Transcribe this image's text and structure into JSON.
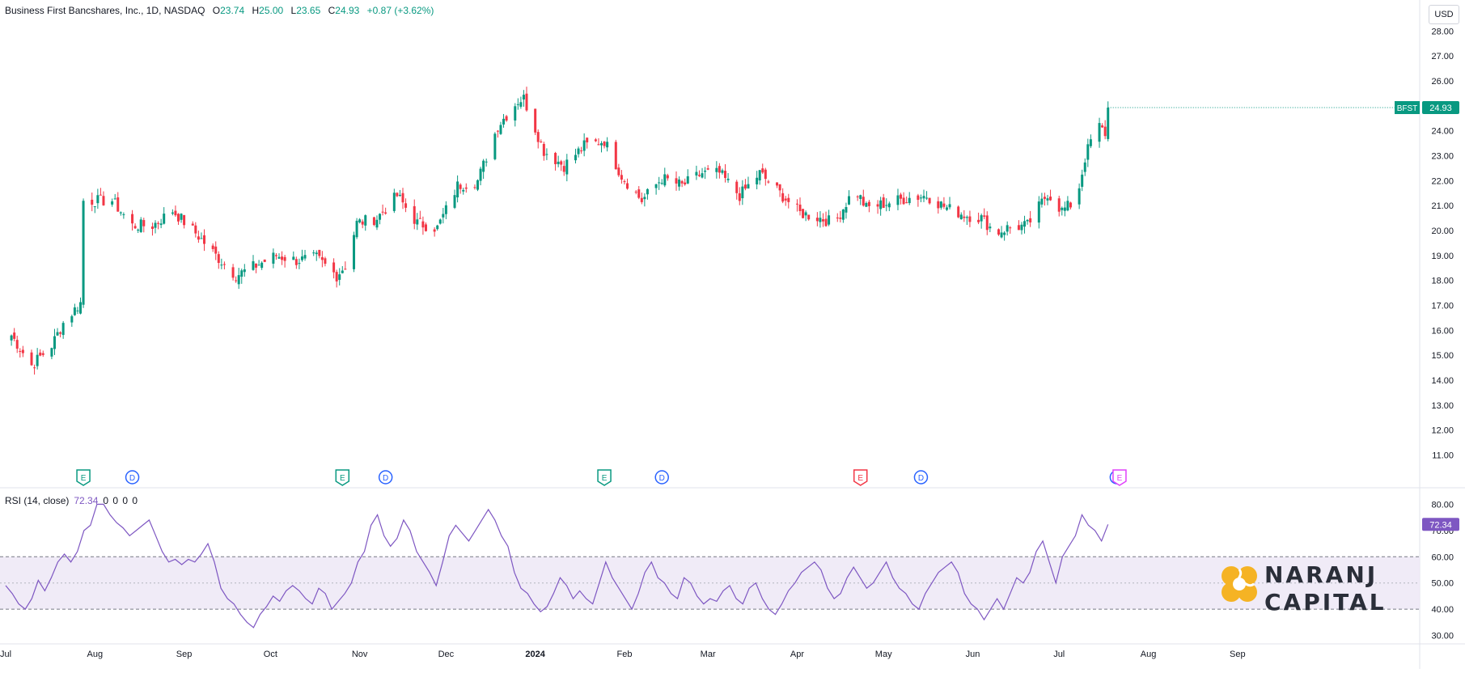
{
  "header": {
    "title": "Business First Bancshares, Inc., 1D, NASDAQ",
    "open_label": "O",
    "open": "23.74",
    "high_label": "H",
    "high": "25.00",
    "low_label": "L",
    "low": "23.65",
    "close_label": "C",
    "close": "24.93",
    "change": "+0.87 (+3.62%)"
  },
  "currency": "USD",
  "rsi_header": {
    "label": "RSI (14, close)",
    "value": "72.34",
    "zeros": "0 0 0 0"
  },
  "brand": {
    "line1": "NARANJ",
    "line2": "CAPITAL"
  },
  "colors": {
    "up": "#089981",
    "down": "#f23645",
    "rsi": "#7e57c2",
    "band": "#ede7f6",
    "brand_orange": "#f5b324"
  },
  "chart_data": [
    {
      "type": "candlestick",
      "title": "Business First Bancshares, Inc., 1D, NASDAQ",
      "symbol": "BFST",
      "last_price": "24.93",
      "y_ticks": [
        "28.00",
        "27.00",
        "26.00",
        "25.00",
        "24.00",
        "23.00",
        "22.00",
        "21.00",
        "20.00",
        "19.00",
        "18.00",
        "17.00",
        "16.00",
        "15.00",
        "14.00",
        "13.00",
        "12.00",
        "11.00"
      ],
      "ylim": [
        10.5,
        28.4
      ],
      "x_ticks": [
        "Jul",
        "Aug",
        "Sep",
        "Oct",
        "Nov",
        "Dec",
        "2024",
        "Feb",
        "Mar",
        "Apr",
        "May",
        "Jun",
        "Jul",
        "Aug",
        "Sep"
      ],
      "close_path": [
        [
          "Jul 3",
          15.8
        ],
        [
          "Jul 10",
          14.6
        ],
        [
          "Jul 17",
          15.4
        ],
        [
          "Jul 21",
          16.3
        ],
        [
          "Jul 27",
          17.1
        ],
        [
          "Jul 28",
          21.2
        ],
        [
          "Aug 7",
          21.2
        ],
        [
          "Aug 14",
          20.2
        ],
        [
          "Aug 21",
          20.2
        ],
        [
          "Aug 28",
          20.8
        ],
        [
          "Sep 5",
          19.9
        ],
        [
          "Sep 12",
          19.0
        ],
        [
          "Sep 19",
          18.2
        ],
        [
          "Sep 26",
          18.6
        ],
        [
          "Oct 3",
          19.0
        ],
        [
          "Oct 10",
          18.8
        ],
        [
          "Oct 17",
          18.9
        ],
        [
          "Oct 24",
          18.2
        ],
        [
          "Oct 27",
          18.6
        ],
        [
          "Oct 31",
          20.3
        ],
        [
          "Nov 7",
          20.5
        ],
        [
          "Nov 14",
          21.4
        ],
        [
          "Nov 21",
          20.3
        ],
        [
          "Nov 28",
          20.1
        ],
        [
          "Dec 5",
          21.8
        ],
        [
          "Dec 12",
          22.0
        ],
        [
          "Dec 19",
          24.2
        ],
        [
          "Dec 26",
          25.2
        ],
        [
          "Dec 28",
          25.3
        ],
        [
          "Jan 4",
          23.2
        ],
        [
          "Jan 11",
          22.6
        ],
        [
          "Jan 18",
          23.4
        ],
        [
          "Jan 25",
          23.6
        ],
        [
          "Jan 31",
          22.2
        ],
        [
          "Feb 7",
          21.2
        ],
        [
          "Feb 14",
          22.1
        ],
        [
          "Feb 21",
          21.8
        ],
        [
          "Feb 28",
          22.3
        ],
        [
          "Mar 6",
          22.3
        ],
        [
          "Mar 13",
          21.4
        ],
        [
          "Mar 20",
          22.3
        ],
        [
          "Mar 27",
          21.5
        ],
        [
          "Apr 3",
          20.7
        ],
        [
          "Apr 10",
          20.5
        ],
        [
          "Apr 15",
          20.3
        ],
        [
          "Apr 22",
          21.7
        ],
        [
          "Apr 26",
          20.9
        ],
        [
          "May 3",
          21.1
        ],
        [
          "May 10",
          21.3
        ],
        [
          "May 17",
          21.4
        ],
        [
          "May 24",
          20.9
        ],
        [
          "May 31",
          20.6
        ],
        [
          "Jun 5",
          20.5
        ],
        [
          "Jun 10",
          19.9
        ],
        [
          "Jun 14",
          20.1
        ],
        [
          "Jun 21",
          20.2
        ],
        [
          "Jun 28",
          21.5
        ],
        [
          "Jul 3",
          20.8
        ],
        [
          "Jul 8",
          21.2
        ],
        [
          "Jul 11",
          22.9
        ],
        [
          "Jul 15",
          24.3
        ],
        [
          "Jul 18",
          23.9
        ],
        [
          "Jul 19",
          24.93
        ]
      ],
      "event_markers": [
        {
          "type": "E",
          "date": "Jul 28"
        },
        {
          "type": "D",
          "date": "Aug 14"
        },
        {
          "type": "E",
          "date": "Oct 26"
        },
        {
          "type": "D",
          "date": "Nov 10"
        },
        {
          "type": "E",
          "date": "Jan 25"
        },
        {
          "type": "D",
          "date": "Feb 14"
        },
        {
          "type": "E",
          "date": "Apr 24"
        },
        {
          "type": "D",
          "date": "May 15"
        },
        {
          "type": "D",
          "date": "Jul 22"
        },
        {
          "type": "E",
          "date": "Jul 23"
        }
      ]
    },
    {
      "type": "line",
      "title": "RSI (14, close)",
      "last_value": "72.34",
      "y_ticks": [
        "80.00",
        "70.00",
        "60.00",
        "50.00",
        "40.00",
        "30.00"
      ],
      "ylim": [
        28,
        86
      ],
      "band": [
        40,
        60
      ],
      "midline": 50,
      "values": [
        49,
        46,
        42,
        40,
        44,
        51,
        47,
        52,
        58,
        61,
        58,
        62,
        70,
        72,
        80,
        80,
        76,
        73,
        71,
        68,
        70,
        72,
        74,
        68,
        62,
        58,
        59,
        57,
        59,
        58,
        61,
        65,
        58,
        48,
        44,
        42,
        38,
        35,
        33,
        38,
        41,
        45,
        43,
        47,
        49,
        47,
        44,
        42,
        48,
        46,
        40,
        43,
        46,
        50,
        58,
        62,
        72,
        76,
        68,
        64,
        67,
        74,
        70,
        62,
        58,
        54,
        49,
        58,
        68,
        72,
        69,
        66,
        70,
        74,
        78,
        74,
        68,
        64,
        54,
        48,
        46,
        42,
        39,
        41,
        46,
        52,
        49,
        44,
        47,
        44,
        42,
        50,
        58,
        52,
        48,
        44,
        40,
        46,
        54,
        58,
        52,
        50,
        46,
        44,
        52,
        50,
        45,
        42,
        44,
        43,
        47,
        49,
        44,
        42,
        48,
        50,
        44,
        40,
        38,
        42,
        47,
        50,
        54,
        56,
        58,
        55,
        48,
        44,
        46,
        52,
        56,
        52,
        48,
        50,
        54,
        58,
        52,
        48,
        46,
        42,
        40,
        46,
        50,
        54,
        56,
        58,
        54,
        46,
        42,
        40,
        36,
        40,
        44,
        40,
        46,
        52,
        50,
        54,
        62,
        66,
        58,
        50,
        60,
        64,
        68,
        76,
        72,
        70,
        66,
        72.34
      ]
    }
  ]
}
